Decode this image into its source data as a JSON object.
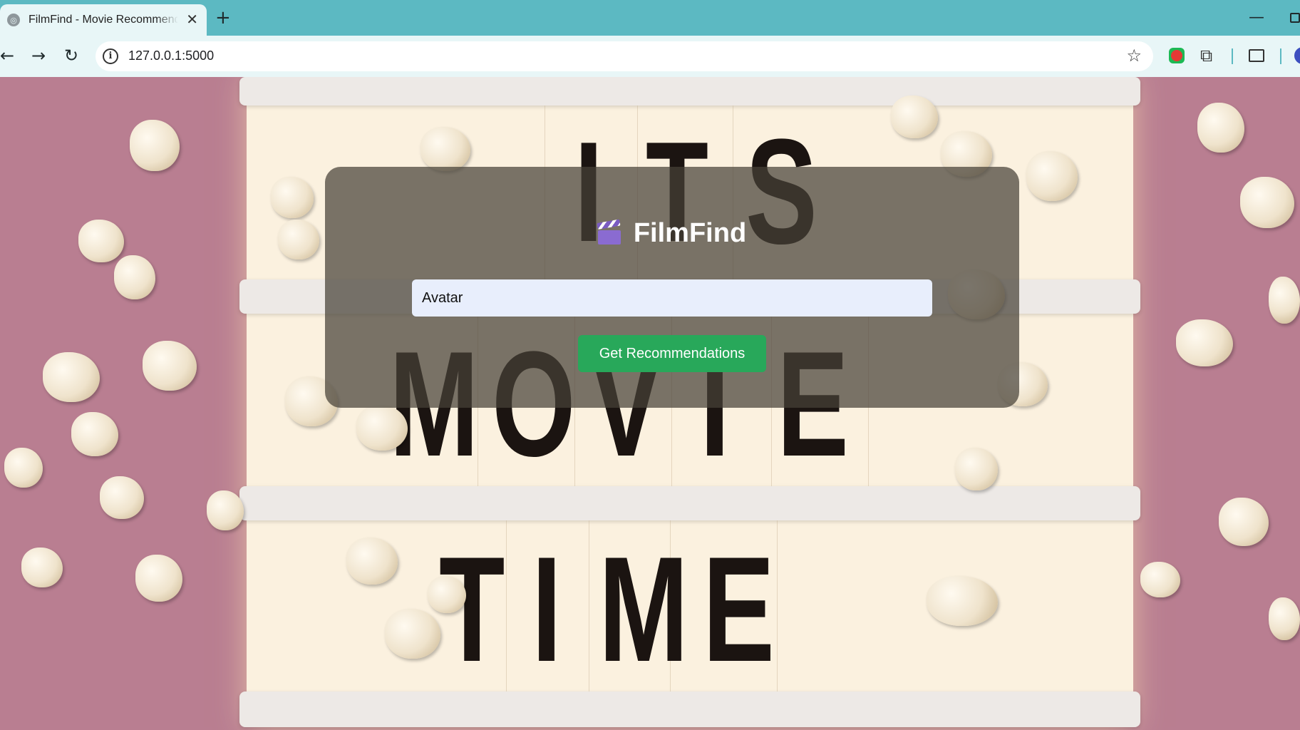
{
  "browser": {
    "tab_title": "FilmFind - Movie Recommender",
    "tab_close": "✕",
    "new_tab": "+",
    "url": "127.0.0.1:5000",
    "icons": [
      "globe-icon",
      "back-icon",
      "forward-icon",
      "reload-icon",
      "info-icon",
      "star-icon",
      "extension-icon",
      "puzzle-icon",
      "cast-icon",
      "profile-icon"
    ],
    "accent_color": "#5cb9c2"
  },
  "background": {
    "lightbox_lines": [
      [
        "I",
        "T",
        "S"
      ],
      [
        "M",
        "O",
        "V",
        "I",
        "E"
      ],
      [
        "T",
        "I",
        "M",
        "E"
      ]
    ]
  },
  "app": {
    "title": "FilmFind",
    "title_icon": "clapper-board-icon",
    "search_value": "Avatar",
    "button_label": "Get Recommendations",
    "button_color": "#28a85a"
  }
}
